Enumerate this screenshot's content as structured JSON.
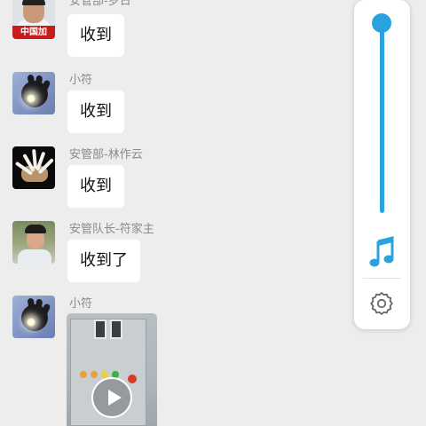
{
  "messages": [
    {
      "sender": "安管部-罗日",
      "text": "收到",
      "avatar_badge": "中国加油！"
    },
    {
      "sender": "小符",
      "text": "收到"
    },
    {
      "sender": "安管部-林作云",
      "text": "收到"
    },
    {
      "sender": "安管队长-符家主",
      "text": "收到了"
    },
    {
      "sender": "小符",
      "type": "video"
    }
  ],
  "volume_overlay": {
    "level": 1.0,
    "accent_color": "#29a3df",
    "icons": [
      "music-note-icon",
      "gear-icon"
    ]
  }
}
